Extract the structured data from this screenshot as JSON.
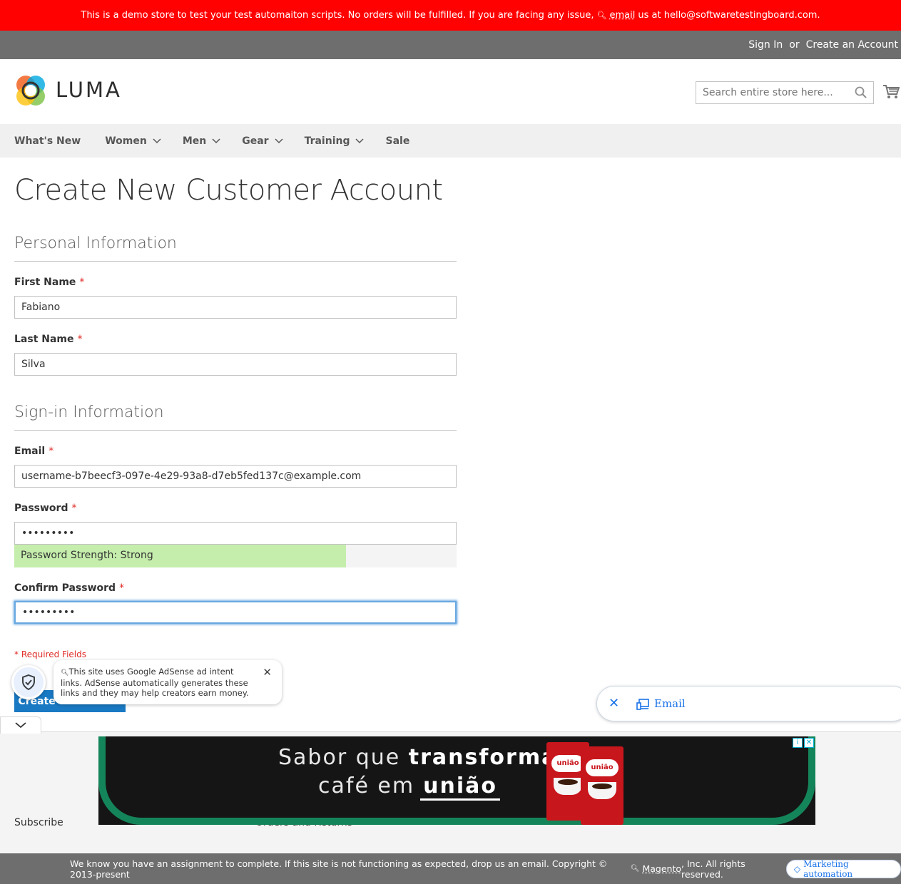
{
  "demo_notice": {
    "text_before": "This is a demo store to test your test automaiton scripts. No orders will be fulfilled. If you are facing any issue,",
    "link": "email",
    "text_after": "us at hello@softwaretestingboard.com."
  },
  "topbar": {
    "sign_in": "Sign In",
    "or": "or",
    "create_account": "Create an Account"
  },
  "header": {
    "logo_text": "LUMA",
    "search_placeholder": "Search entire store here..."
  },
  "nav": [
    {
      "label": "What's New",
      "has_dropdown": false
    },
    {
      "label": "Women",
      "has_dropdown": true
    },
    {
      "label": "Men",
      "has_dropdown": true
    },
    {
      "label": "Gear",
      "has_dropdown": true
    },
    {
      "label": "Training",
      "has_dropdown": true
    },
    {
      "label": "Sale",
      "has_dropdown": false
    }
  ],
  "page_title": "Create New Customer Account",
  "personal": {
    "title": "Personal Information",
    "first_name_label": "First Name",
    "first_name_value": "Fabiano",
    "last_name_label": "Last Name",
    "last_name_value": "Silva"
  },
  "signin": {
    "title": "Sign-in Information",
    "email_label": "Email",
    "email_value": "username-b7beecf3-097e-4e29-93a8-d7eb5fed137c@example.com",
    "password_label": "Password",
    "password_value": "•••••••••",
    "strength_text": "Password Strength: Strong",
    "strength_fraction": 0.75,
    "confirm_label": "Confirm Password",
    "confirm_value": "•••••••••"
  },
  "required_marker": "*",
  "required_note": "* Required Fields",
  "create_button": "Create an Account",
  "adsense_popup": {
    "text": "This site uses Google AdSense ad intent links. AdSense automatically generates these links and they may help creators earn money.",
    "close": "✕"
  },
  "email_pill": {
    "close": "✕",
    "label": "Email"
  },
  "footer": {
    "link1": "Subscribe",
    "link2": "Orders and Returns"
  },
  "ad": {
    "line1_prefix": "Sabor que",
    "line1_bold": "transforma",
    "line2_prefix": "café em",
    "brand": "união",
    "pack_label": "união"
  },
  "bottom_bar": {
    "text_before": "We know you have an assignment to complete. If this site is not functioning as expected, drop us an email. Copyright © 2013-present",
    "link": "Magento",
    "text_after": ", Inc. All rights reserved.",
    "marketing": "Marketing automation"
  },
  "colors": {
    "notice_red": "#ff0101",
    "topbar_gray": "#6e6e6e",
    "button_blue": "#1979c3",
    "strength_green": "#c5eeac",
    "required_red": "#e02b27",
    "ad_green": "#14855a"
  }
}
